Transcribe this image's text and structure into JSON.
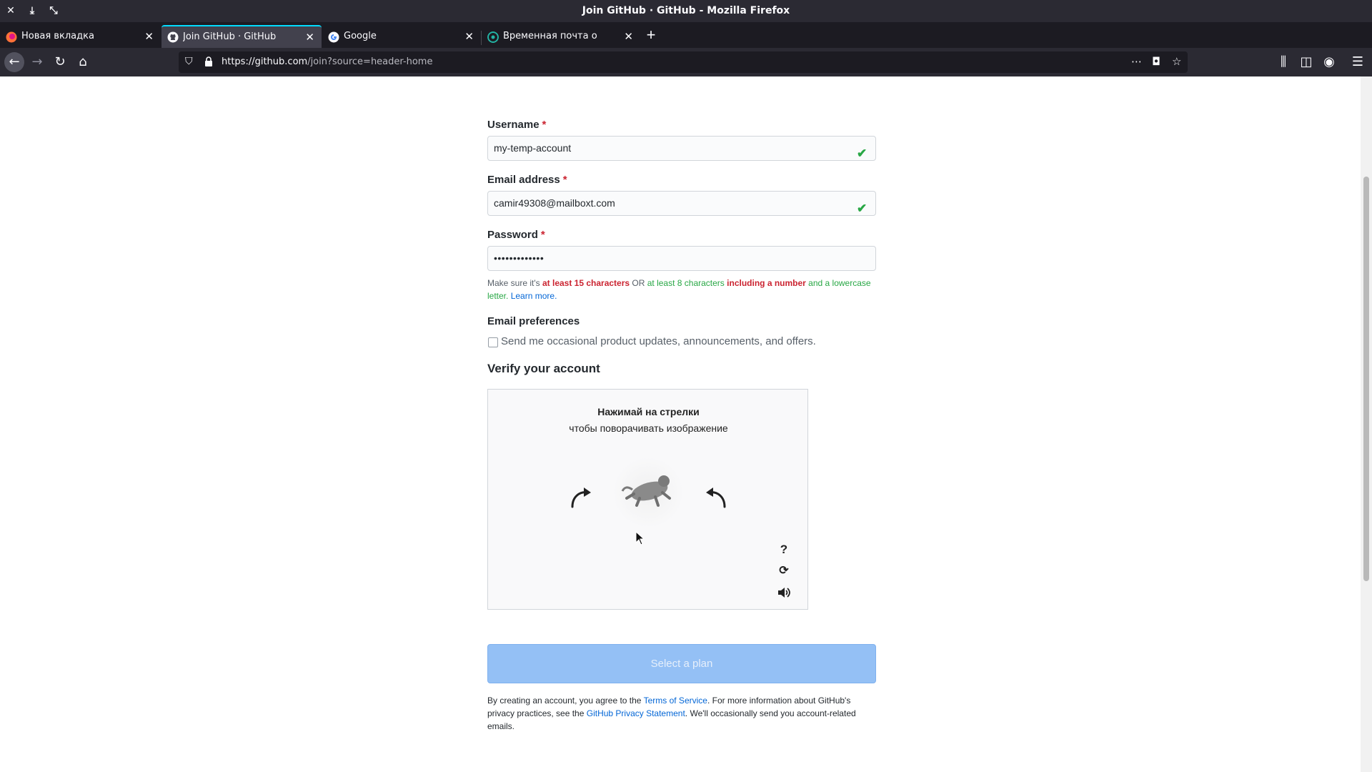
{
  "window": {
    "title": "Join GitHub · GitHub - Mozilla Firefox"
  },
  "tabs": [
    {
      "label": "Новая вкладка",
      "active": false
    },
    {
      "label": "Join GitHub · GitHub",
      "active": true
    },
    {
      "label": "Google",
      "active": false
    },
    {
      "label": "Временная почта от Temp-M",
      "active": false
    }
  ],
  "navbar": {
    "url_domain": "https://github.com",
    "url_path": "/join?source=header-home"
  },
  "form": {
    "username": {
      "label": "Username",
      "required_mark": "*",
      "value": "my-temp-account"
    },
    "email": {
      "label": "Email address",
      "required_mark": "*",
      "value": "camir49308@mailboxt.com"
    },
    "password": {
      "label": "Password",
      "required_mark": "*",
      "value": "•••••••••••••"
    },
    "password_hint": {
      "p1": "Make sure it's ",
      "p2": "at least 15 characters",
      "p3": " OR ",
      "p4": "at least 8 characters",
      "p5": " ",
      "p6": "including a number",
      "p7": " and a lowercase letter.",
      "p8": " ",
      "link": "Learn more."
    },
    "email_prefs": {
      "title": "Email preferences",
      "checkbox_label": "Send me occasional product updates, announcements, and offers.",
      "checked": false
    },
    "verify": {
      "title": "Verify your account",
      "instruction_title": "Нажимай на стрелки",
      "instruction_sub": "чтобы поворачивать изображение",
      "help_label": "?"
    },
    "submit_label": "Select a plan",
    "legal": {
      "t1": "By creating an account, you agree to the ",
      "terms_link": "Terms of Service",
      "t2": ". For more information about GitHub's privacy practices, see the ",
      "privacy_link": "GitHub Privacy Statement",
      "t3": ". We'll occasionally send you account-related emails."
    }
  },
  "colors": {
    "accent_link": "#0366d6",
    "error_red": "#cb2431",
    "success_green": "#28a745",
    "button_disabled": "#94c0f5"
  }
}
